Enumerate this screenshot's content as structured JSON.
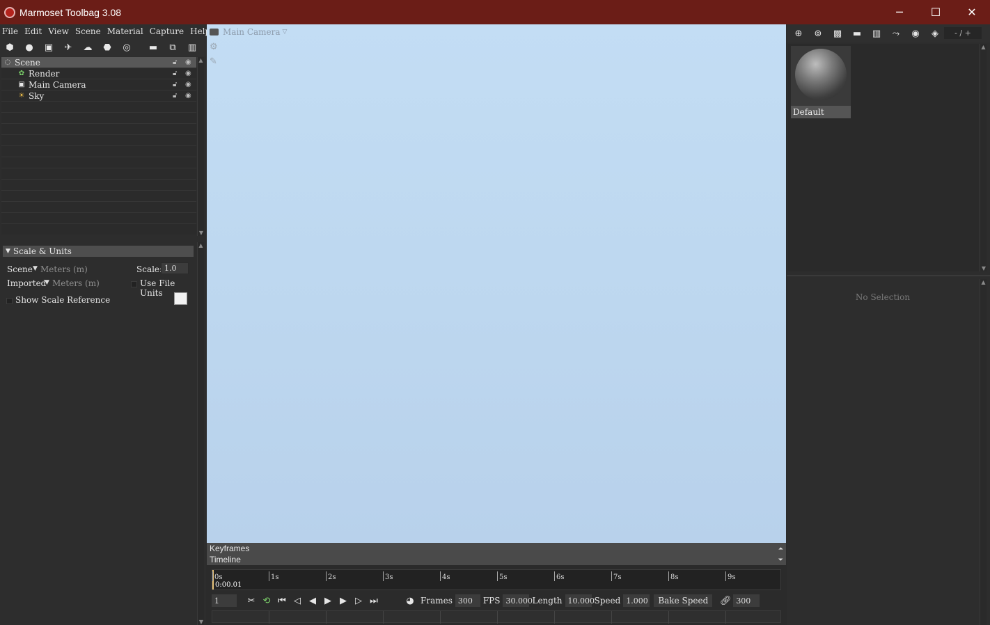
{
  "window": {
    "title": "Marmoset Toolbag 3.08",
    "controls": {
      "minimize": "─",
      "maximize": "☐",
      "close": "✕"
    }
  },
  "menu": [
    "File",
    "Edit",
    "View",
    "Scene",
    "Material",
    "Capture",
    "Help"
  ],
  "scene_tree": {
    "items": [
      {
        "label": "Scene",
        "icon": "scene-icon",
        "selected": true
      },
      {
        "label": "Render",
        "icon": "render-icon"
      },
      {
        "label": "Main Camera",
        "icon": "camera-icon"
      },
      {
        "label": "Sky",
        "icon": "sky-icon"
      }
    ]
  },
  "properties": {
    "section_title": "Scale & Units",
    "scene_label": "Scene",
    "scene_units": "Meters (m)",
    "scale_label": "Scale:",
    "scale_value": "1.0",
    "imported_label": "Imported",
    "imported_units": "Meters (m)",
    "use_file_units_label": "Use File Units",
    "show_scale_ref_label": "Show Scale Reference"
  },
  "viewport": {
    "camera_label": "Main Camera"
  },
  "timeline": {
    "keyframes_label": "Keyframes",
    "timeline_label": "Timeline",
    "ticks": [
      "0s",
      "1s",
      "2s",
      "3s",
      "4s",
      "5s",
      "6s",
      "7s",
      "8s",
      "9s"
    ],
    "current_time": "0:00.01",
    "frame_value": "1",
    "frames_label": "Frames",
    "frames_value": "300",
    "fps_label": "FPS",
    "fps_value": "30.000",
    "length_label": "Length",
    "length_value": "10.000",
    "speed_label": "Speed",
    "speed_value": "1.000",
    "bake_speed_label": "Bake Speed",
    "link_value": "300"
  },
  "material_panel": {
    "pager": "- / +",
    "materials": [
      {
        "name": "Default"
      }
    ],
    "no_selection": "No Selection"
  }
}
